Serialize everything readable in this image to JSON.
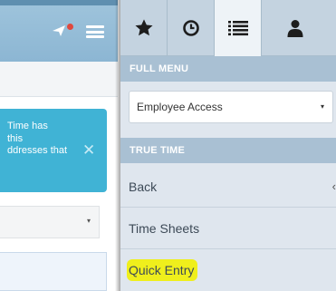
{
  "background_app": {
    "alert_text": "Time has\nthis\nddresses that",
    "close_glyph": "✕",
    "select_caret": "▾"
  },
  "tabs": [
    {
      "name": "favorites",
      "icon": "star-icon",
      "active": false
    },
    {
      "name": "recent",
      "icon": "clock-icon",
      "active": false
    },
    {
      "name": "menu",
      "icon": "list-icon",
      "active": true
    },
    {
      "name": "account",
      "icon": "person-icon",
      "active": false
    }
  ],
  "full_menu": {
    "header": "FULL MENU",
    "selected_value": "Employee Access",
    "caret": "▾"
  },
  "true_time": {
    "header": "TRUE TIME",
    "items": [
      {
        "label": "Back",
        "chevron": "‹"
      },
      {
        "label": "Time Sheets"
      },
      {
        "label": "Quick Entry",
        "highlighted": true
      }
    ]
  },
  "colors": {
    "accent": "#40b3d5",
    "section_header": "#a9c0d3",
    "highlight": "#efef1c",
    "notification": "#e0483d"
  }
}
